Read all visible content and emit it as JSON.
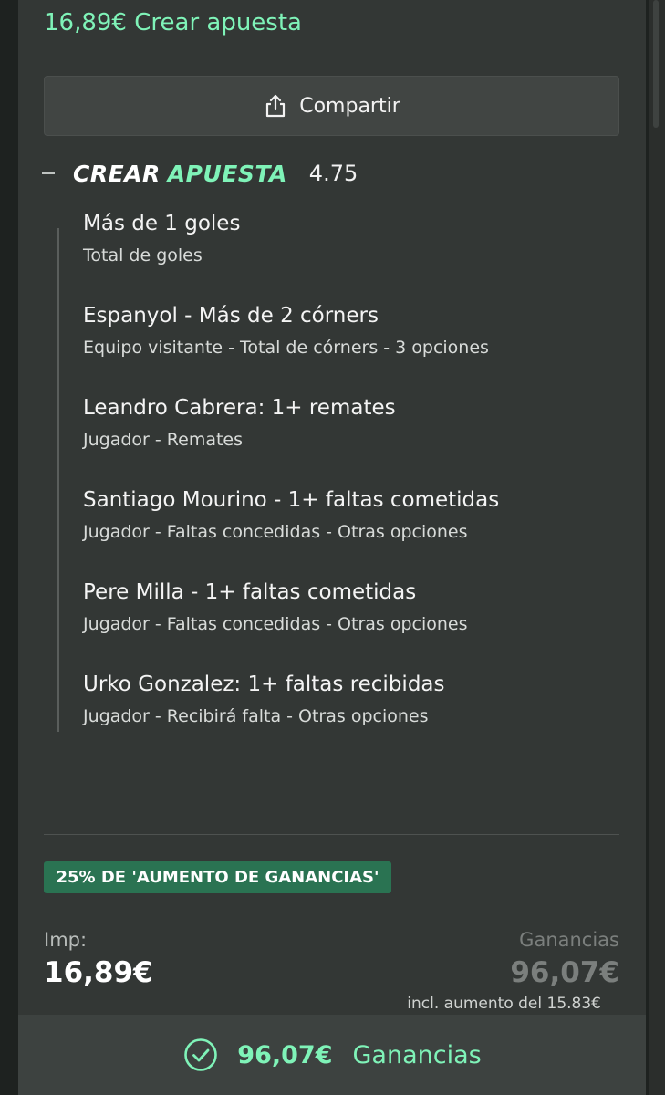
{
  "header": {
    "title": "16,89€ Crear apuesta"
  },
  "share": {
    "label": "Compartir",
    "icon": "share-icon"
  },
  "bet_builder": {
    "brand_word1": "CREAR",
    "brand_word2": "APUESTA",
    "odds": "4.75",
    "selections": [
      {
        "title": "Más de 1 goles",
        "subtitle": "Total de goles"
      },
      {
        "title": "Espanyol - Más de 2 córners",
        "subtitle": "Equipo visitante - Total de córners - 3 opciones"
      },
      {
        "title": "Leandro Cabrera: 1+ remates",
        "subtitle": "Jugador - Remates"
      },
      {
        "title": "Santiago Mourino - 1+ faltas cometidas",
        "subtitle": "Jugador - Faltas concedidas - Otras opciones"
      },
      {
        "title": "Pere Milla - 1+ faltas cometidas",
        "subtitle": "Jugador - Faltas concedidas - Otras opciones"
      },
      {
        "title": "Urko Gonzalez: 1+ faltas recibidas",
        "subtitle": "Jugador - Recibirá falta - Otras opciones"
      }
    ]
  },
  "boost": {
    "label": "25% DE 'AUMENTO DE GANANCIAS'"
  },
  "stake": {
    "label": "Imp:",
    "value": "16,89€"
  },
  "winnings": {
    "label": "Ganancias",
    "value": "96,07€",
    "note": "incl. aumento del 15.83€"
  },
  "cta": {
    "amount": "96,07€",
    "label": "Ganancias",
    "icon": "check-circle-icon"
  },
  "colors": {
    "accent": "#7ff3b8",
    "badge": "#2a7352",
    "panel": "#333735",
    "background": "#1e2220"
  }
}
